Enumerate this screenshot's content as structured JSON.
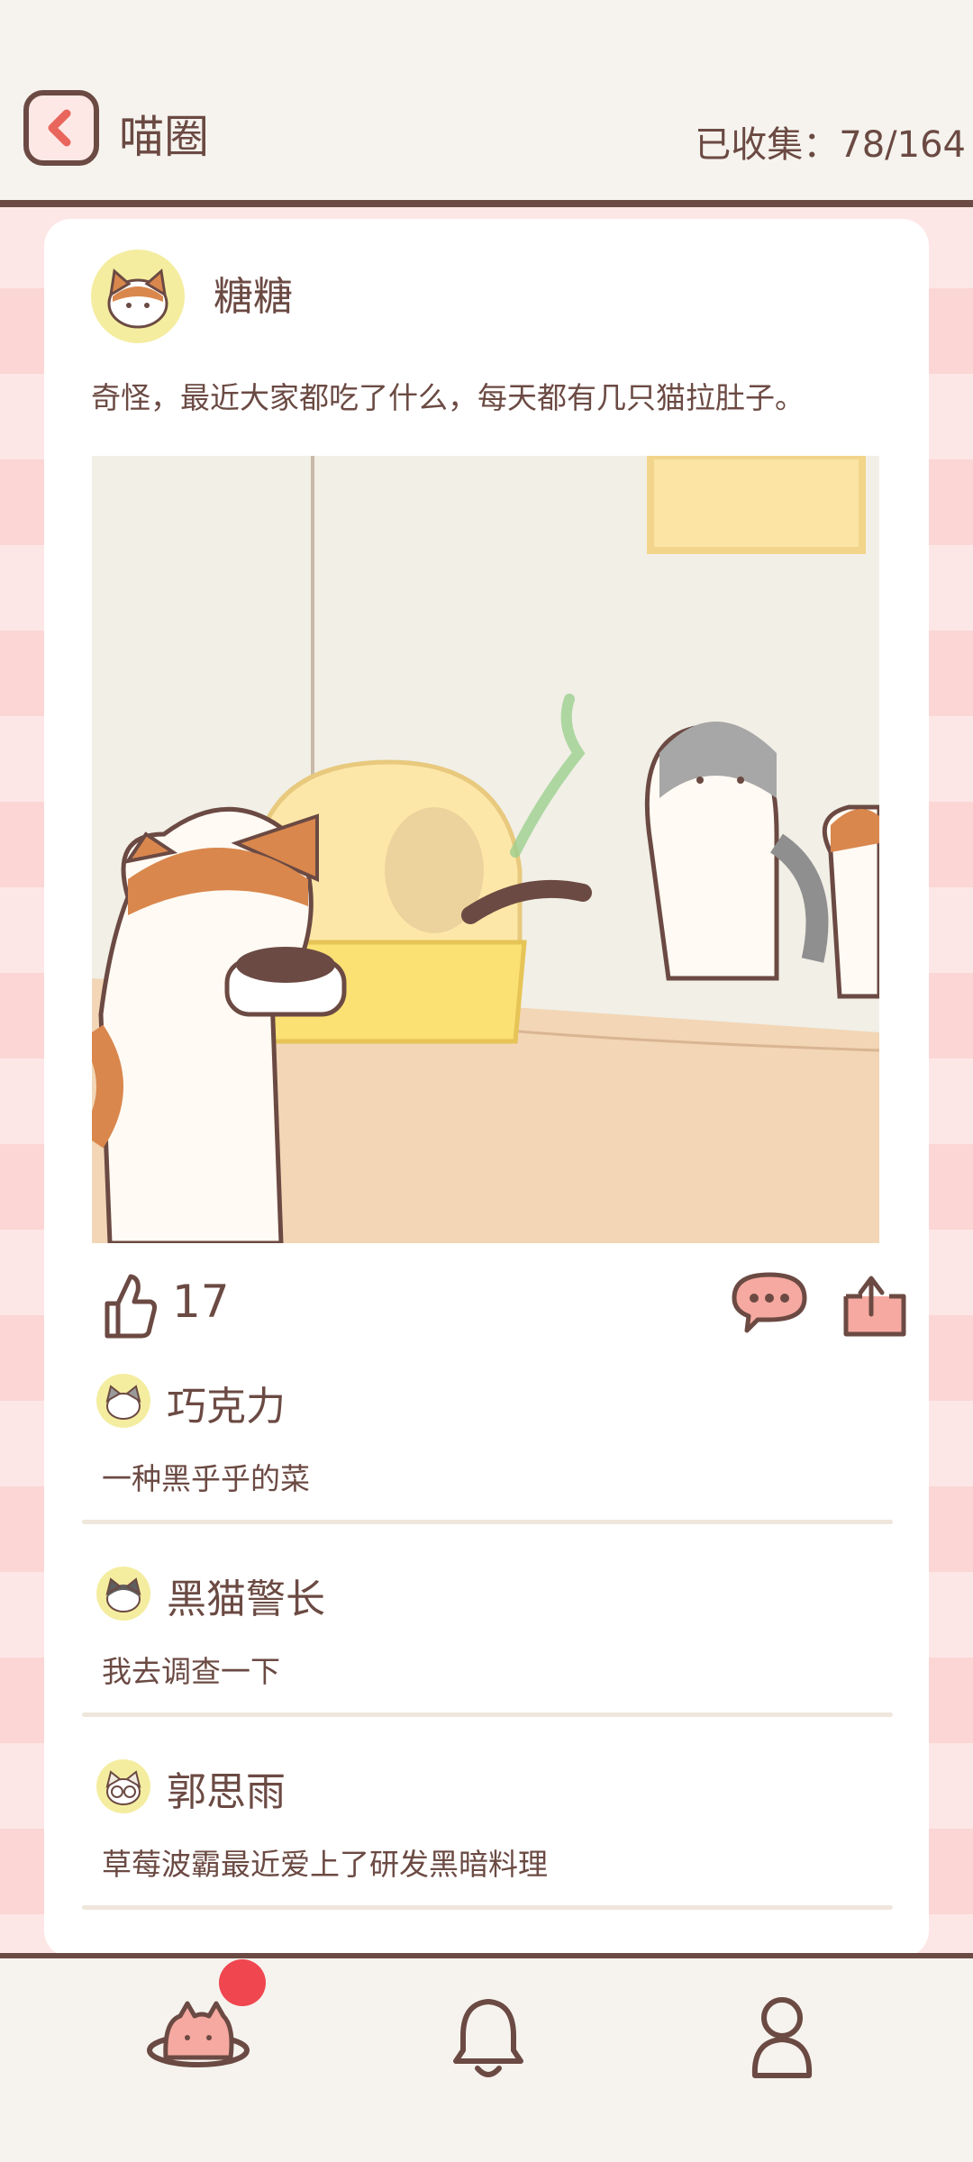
{
  "header": {
    "title": "喵圈",
    "collected_label": "已收集：78/164"
  },
  "post": {
    "author": "糖糖",
    "text": "奇怪，最近大家都吃了什么，每天都有几只猫拉肚子。",
    "likes": "17"
  },
  "comments": [
    {
      "name": "巧克力",
      "text": "一种黑乎乎的菜"
    },
    {
      "name": "黑猫警长",
      "text": "我去调查一下"
    },
    {
      "name": "郭思雨",
      "text": "草莓波霸最近爱上了研发黑暗料理"
    }
  ],
  "nav": {
    "items": [
      "planet-cat-icon",
      "bell-icon",
      "profile-icon"
    ],
    "badge_color": "#f0464f"
  },
  "colors": {
    "primary_brown": "#6b4a43",
    "pink_bg": "#fbe3e2",
    "avatar_yellow": "#f4eda0"
  }
}
